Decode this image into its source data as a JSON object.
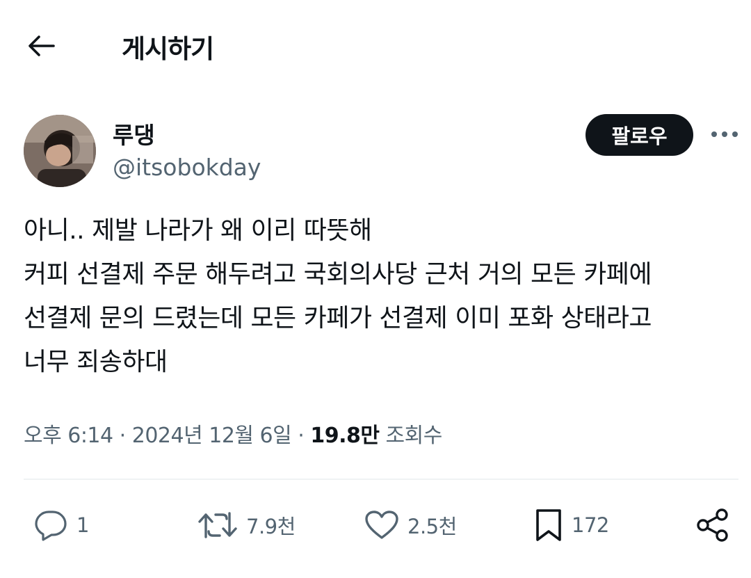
{
  "header": {
    "title": "게시하기"
  },
  "author": {
    "display_name": "루댕",
    "handle": "@itsobokday"
  },
  "follow_label": "팔로우",
  "tweet": {
    "lines": [
      "아니.. 제발 나라가 왜 이리 따뜻해",
      "커피 선결제 주문 해두려고 국회의사당 근처 거의 모든 카페에",
      "선결제 문의 드렸는데 모든 카페가 선결제 이미 포화 상태라고",
      "너무 죄송하대"
    ]
  },
  "meta": {
    "time": "오후 6:14",
    "separator": "·",
    "date": "2024년 12월 6일",
    "views": "19.8만",
    "views_label": "조회수"
  },
  "actions": {
    "reply_count": "1",
    "retweet_count": "7.9천",
    "like_count": "2.5천",
    "bookmark_count": "172"
  },
  "icons": [
    "back-arrow-icon",
    "more-icon",
    "reply-icon",
    "retweet-icon",
    "like-icon",
    "bookmark-icon",
    "share-icon"
  ],
  "colors": {
    "text": "#0f1419",
    "secondary": "#536471",
    "follow_bg": "#0f1419",
    "divider": "#eff3f4"
  }
}
